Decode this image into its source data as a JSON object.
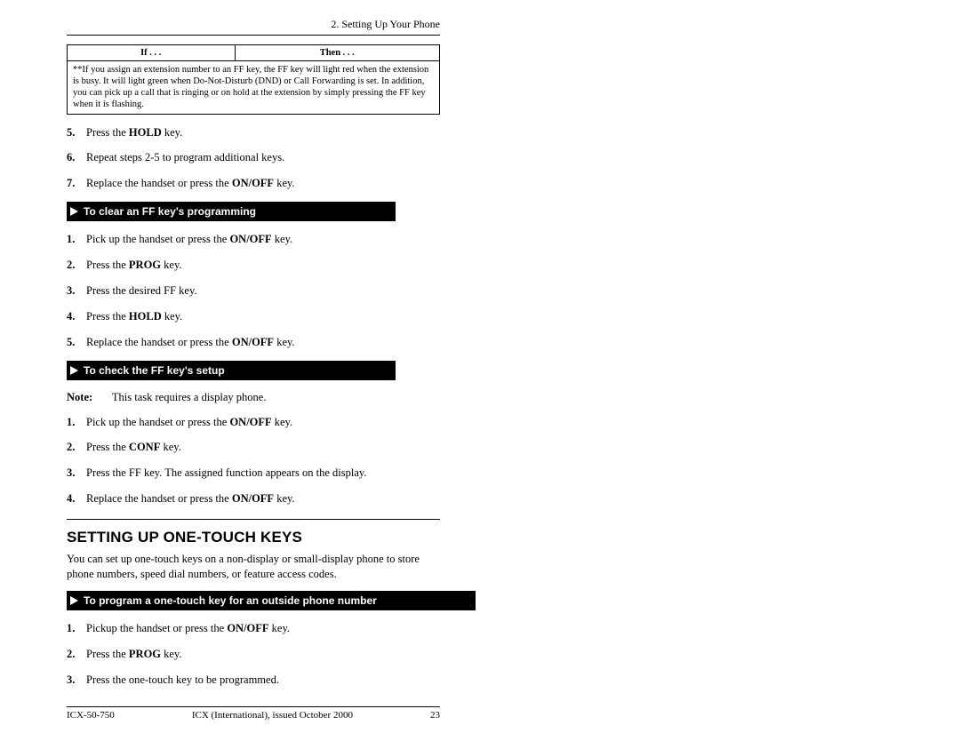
{
  "header": {
    "chapter": "2. Setting Up Your Phone"
  },
  "table": {
    "col1": "If . . .",
    "col2": "Then . . .",
    "note": "**If you assign an extension number to an FF key, the FF key will light red when the extension is busy. It will light green when Do-Not-Disturb (DND) or Call Forwarding is set. In addition, you can pick up a call that is ringing or on hold at the extension by simply pressing the FF key when it is flashing."
  },
  "steps_top": [
    {
      "n": "5.",
      "before": "Press the ",
      "bold": "HOLD",
      "after": " key."
    },
    {
      "n": "6.",
      "before": "Repeat steps 2-5 to program additional keys.",
      "bold": "",
      "after": ""
    },
    {
      "n": "7.",
      "before": "Replace the handset or press the ",
      "bold": "ON/OFF",
      "after": " key."
    }
  ],
  "bar1": "To clear an FF key's programming",
  "steps_clear": [
    {
      "n": "1.",
      "before": "Pick up the handset or press the ",
      "bold": "ON/OFF",
      "after": " key."
    },
    {
      "n": "2.",
      "before": "Press the ",
      "bold": "PROG",
      "after": " key."
    },
    {
      "n": "3.",
      "before": "Press the desired FF key.",
      "bold": "",
      "after": ""
    },
    {
      "n": "4.",
      "before": "Press the ",
      "bold": "HOLD",
      "after": " key."
    },
    {
      "n": "5.",
      "before": "Replace the handset or press the ",
      "bold": "ON/OFF",
      "after": " key."
    }
  ],
  "bar2": "To check the FF key's setup",
  "note_check": {
    "label": "Note:",
    "text": "This task requires a display phone."
  },
  "steps_check": [
    {
      "n": "1.",
      "before": "Pick up the handset or press the ",
      "bold": "ON/OFF",
      "after": " key."
    },
    {
      "n": "2.",
      "before": "Press the ",
      "bold": "CONF",
      "after": " key."
    },
    {
      "n": "3.",
      "before": "Press the FF key.  The assigned function appears on the display.",
      "bold": "",
      "after": ""
    },
    {
      "n": "4.",
      "before": "Replace the handset or press the ",
      "bold": "ON/OFF",
      "after": " key."
    }
  ],
  "section_title": "SETTING UP ONE-TOUCH KEYS",
  "section_body": "You can set up one-touch keys on a non-display or small-display phone to store phone numbers, speed dial numbers, or feature access codes.",
  "bar3": "To program a one-touch key for an outside phone number",
  "steps_program": [
    {
      "n": "1.",
      "before": "Pickup the handset or press the ",
      "bold": "ON/OFF",
      "after": " key."
    },
    {
      "n": "2.",
      "before": "Press the ",
      "bold": "PROG",
      "after": " key."
    },
    {
      "n": "3.",
      "before": "Press the one-touch key to be programmed.",
      "bold": "",
      "after": ""
    }
  ],
  "footer": {
    "left": "ICX-50-750",
    "mid": "ICX (International), issued October 2000",
    "right": "23"
  }
}
